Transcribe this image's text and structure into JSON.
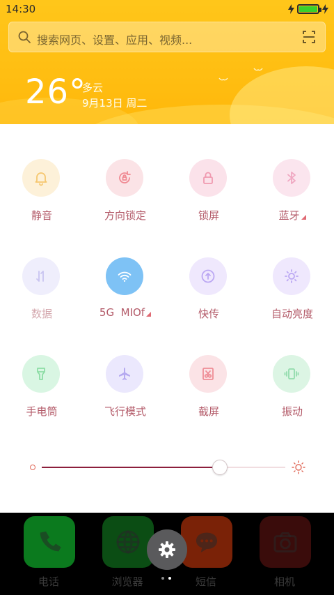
{
  "status": {
    "time": "14:30"
  },
  "search": {
    "placeholder": "搜索网页、设置、应用、视频..."
  },
  "weather": {
    "temperature": "26°",
    "condition": "多云",
    "date": "9月13日 周二"
  },
  "toggles": [
    {
      "label": "静音",
      "icon": "bell-icon",
      "bg": "#fdf1d9",
      "color": "#f6c76f",
      "active": false
    },
    {
      "label": "方向锁定",
      "icon": "rotation-lock-icon",
      "bg": "#fbe3e6",
      "color": "#f08a93",
      "active": false
    },
    {
      "label": "锁屏",
      "icon": "lock-icon",
      "bg": "#fbe2ea",
      "color": "#f09ab0",
      "active": false
    },
    {
      "label": "蓝牙",
      "icon": "bluetooth-icon",
      "bg": "#fbe5ee",
      "color": "#f0a8c2",
      "active": false,
      "expandable": true
    },
    {
      "label": "数据",
      "icon": "data-icon",
      "bg": "#efeefc",
      "color": "#c9c4f0",
      "active": false
    },
    {
      "label": "5G  MIOf",
      "icon": "wifi-icon",
      "bg": "#7ec2f5",
      "color": "#ffffff",
      "active": true,
      "expandable": true
    },
    {
      "label": "快传",
      "icon": "quick-share-icon",
      "bg": "#efe8fd",
      "color": "#bba7f3",
      "active": false
    },
    {
      "label": "自动亮度",
      "icon": "auto-brightness-icon",
      "bg": "#efe8fd",
      "color": "#bba7f3",
      "active": false
    },
    {
      "label": "手电筒",
      "icon": "flashlight-icon",
      "bg": "#d9f6e3",
      "color": "#8ddda5",
      "active": false
    },
    {
      "label": "飞行模式",
      "icon": "airplane-icon",
      "bg": "#ebe8fd",
      "color": "#b5a9f0",
      "active": false
    },
    {
      "label": "截屏",
      "icon": "screenshot-icon",
      "bg": "#fbe3e6",
      "color": "#ef8d96",
      "active": false
    },
    {
      "label": "振动",
      "icon": "vibrate-icon",
      "bg": "#dcf5e4",
      "color": "#92dcac",
      "active": false
    }
  ],
  "brightness": {
    "level_percent": 73
  },
  "dock": [
    {
      "label": "电话",
      "icon": "phone-icon",
      "bg": "#0b7a1e"
    },
    {
      "label": "浏览器",
      "icon": "browser-icon",
      "bg": "#0b4d14"
    },
    {
      "label": "短信",
      "icon": "message-icon",
      "bg": "#7a2207"
    },
    {
      "label": "相机",
      "icon": "camera-icon",
      "bg": "#3a0c0b"
    }
  ],
  "page_indicator": {
    "count": 2,
    "active": 1
  }
}
